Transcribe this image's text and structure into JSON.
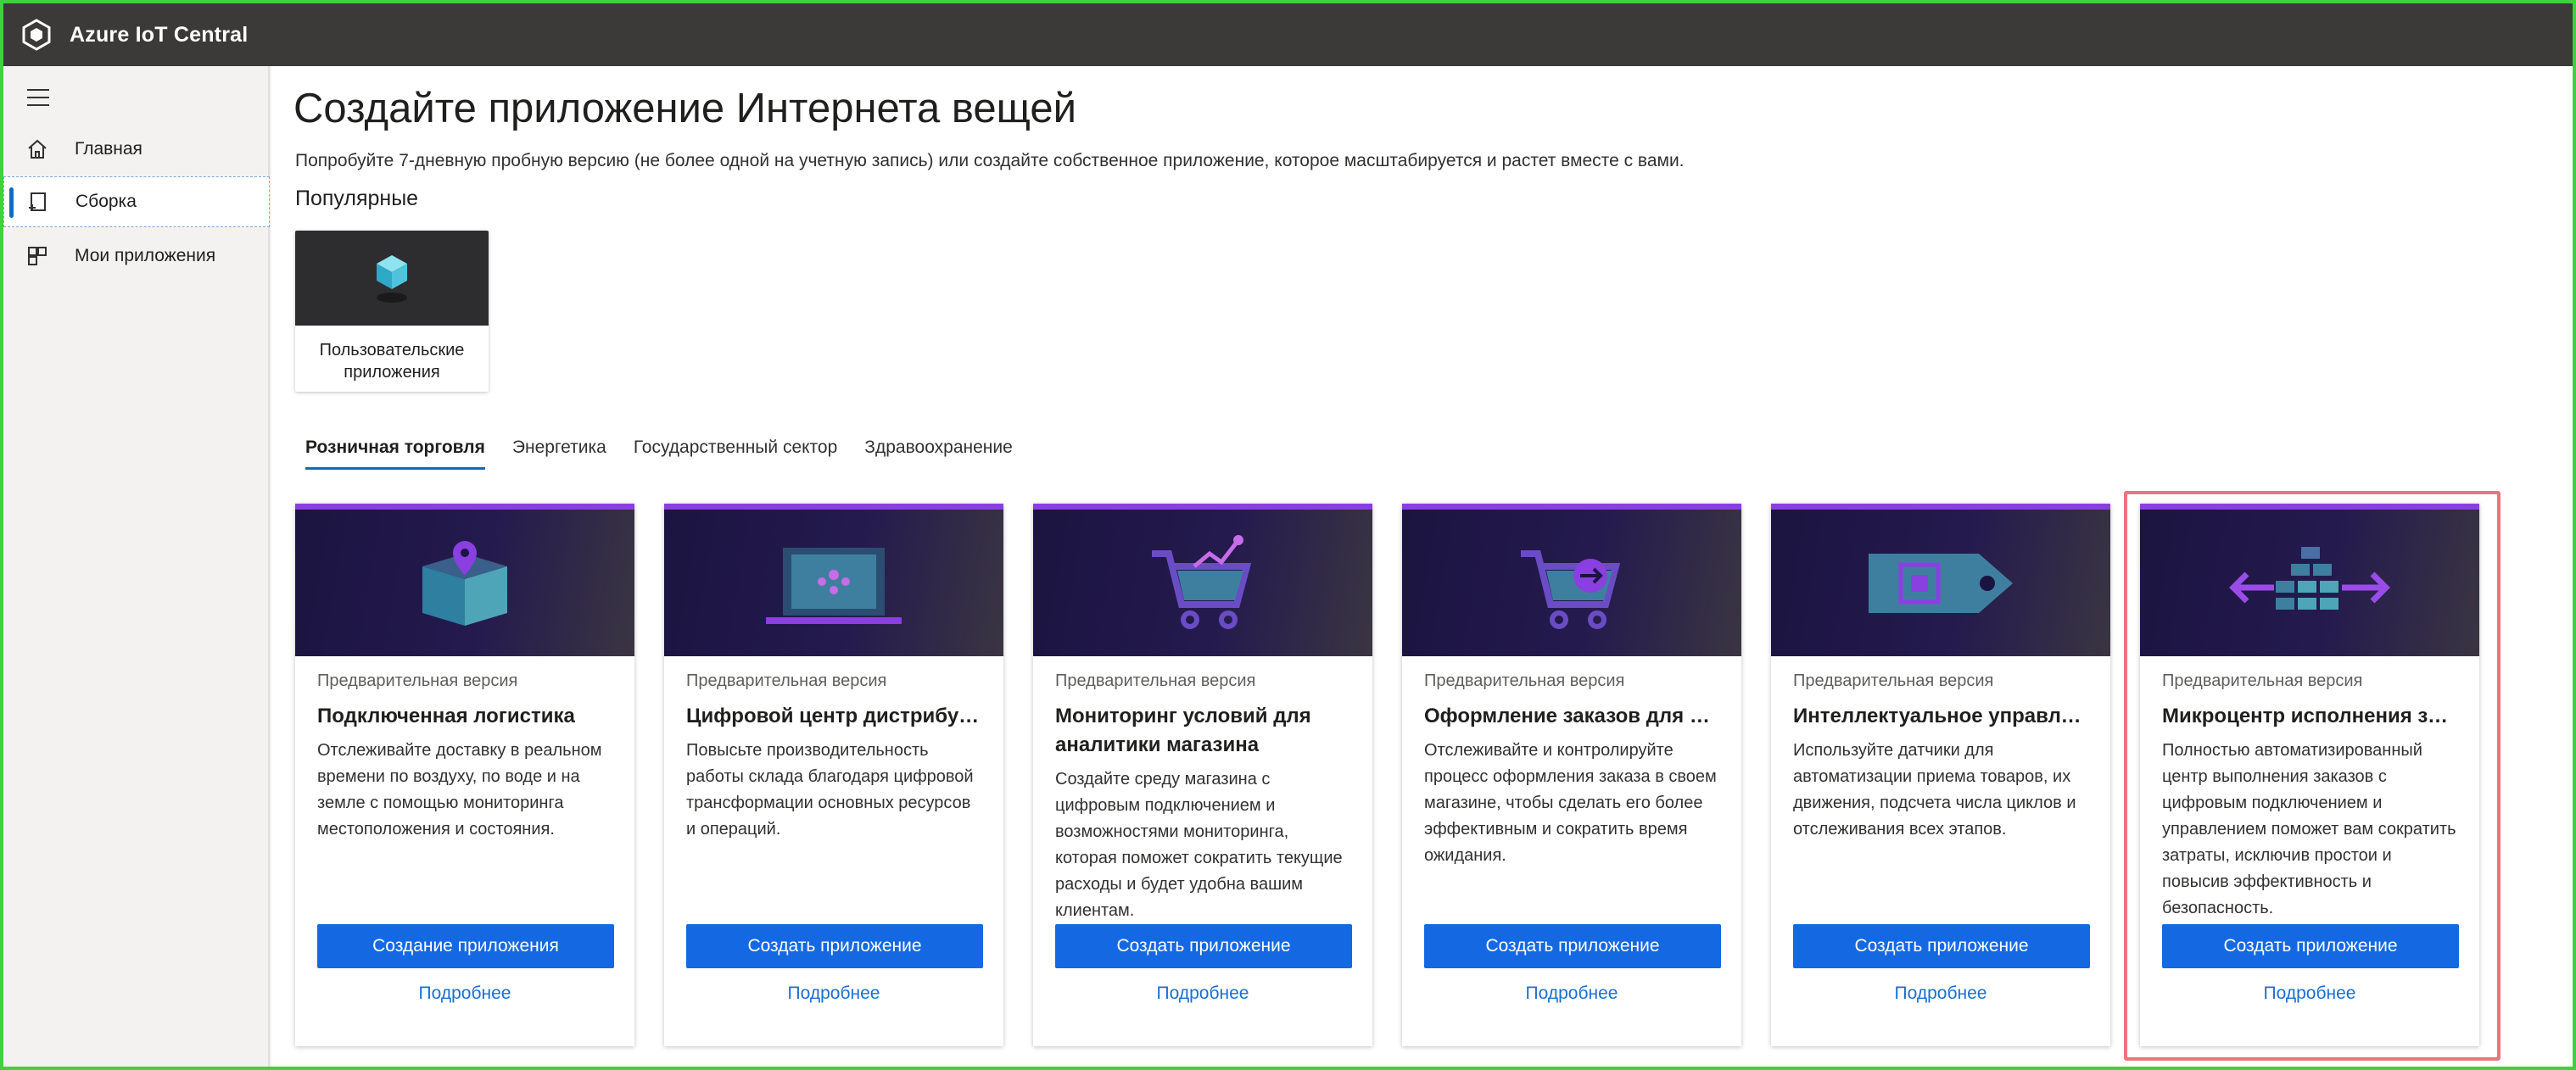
{
  "app": {
    "title": "Azure IoT Central"
  },
  "sidebar": {
    "items": [
      {
        "label": "Главная",
        "icon": "home-icon"
      },
      {
        "label": "Сборка",
        "icon": "build-icon"
      },
      {
        "label": "Мои приложения",
        "icon": "apps-icon"
      }
    ]
  },
  "main": {
    "title": "Создайте приложение Интернета вещей",
    "subtitle": "Попробуйте 7-дневную пробную версию (не более одной на учетную запись) или создайте собственное приложение, которое масштабируется и растет вместе с вами.",
    "popular_heading": "Популярные",
    "custom_app_label": "Пользовательские приложения",
    "tabs": [
      {
        "label": "Розничная торговля"
      },
      {
        "label": "Энергетика"
      },
      {
        "label": "Государственный сектор"
      },
      {
        "label": "Здравоохранение"
      }
    ],
    "cards": [
      {
        "badge": "Предварительная версия",
        "title": "Подключенная логистика",
        "description": "Отслеживайте доставку в реальном времени по воздуху, по воде и на земле с помощью мониторинга местоположения и состояния.",
        "button": "Создание приложения",
        "link": "Подробнее"
      },
      {
        "badge": "Предварительная версия",
        "title": "Цифровой центр дистрибуции",
        "description": "Повысьте производительность работы склада благодаря цифровой трансформации основных ресурсов и операций.",
        "button": "Создать приложение",
        "link": "Подробнее"
      },
      {
        "badge": "Предварительная версия",
        "title": "Мониторинг условий для аналитики магазина",
        "description": "Создайте среду магазина с цифровым подключением и возможностями мониторинга, которая поможет сократить текущие расходы и будет удобна вашим клиентам.",
        "button": "Создать приложение",
        "link": "Подробнее"
      },
      {
        "badge": "Предварительная версия",
        "title": "Оформление заказов для ан...",
        "description": "Отслеживайте и контролируйте процесс оформления заказа в своем магазине, чтобы сделать его более эффективным и сократить время ожидания.",
        "button": "Создать приложение",
        "link": "Подробнее"
      },
      {
        "badge": "Предварительная версия",
        "title": "Интеллектуальное управлен...",
        "description": "Используйте датчики для автоматизации приема товаров, их движения, подсчета числа циклов и отслеживания всех этапов.",
        "button": "Создать приложение",
        "link": "Подробнее"
      },
      {
        "badge": "Предварительная версия",
        "title": "Микроцентр исполнения зак...",
        "description": "Полностью автоматизированный центр выполнения заказов с цифровым подключением и управлением поможет вам сократить затраты, исключив простои и повысив эффективность и безопасность.",
        "button": "Создать приложение",
        "link": "Подробнее"
      }
    ]
  },
  "colors": {
    "accent": "#1469e3",
    "topbar": "#3b3a39",
    "hero_stripe": "#8a3fe0",
    "highlight": "#e8767c"
  }
}
